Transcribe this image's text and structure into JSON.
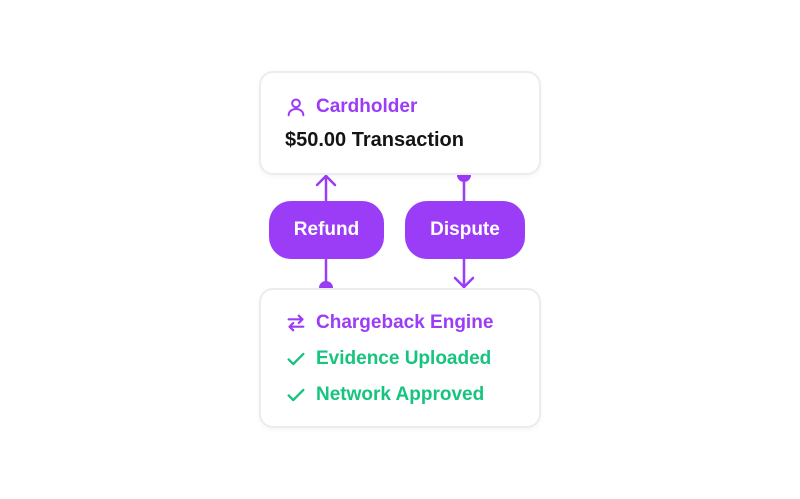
{
  "colors": {
    "accent": "#9b3cf6",
    "success": "#16c47f",
    "text": "#141414"
  },
  "cardholder": {
    "title": "Cardholder",
    "title_icon": "user-icon",
    "transaction": "$50.00 Transaction"
  },
  "actions": {
    "refund": "Refund",
    "dispute": "Dispute"
  },
  "engine": {
    "title": "Chargeback Engine",
    "title_icon": "swap-arrows-icon",
    "steps": [
      {
        "label": "Evidence Uploaded",
        "icon": "check-icon"
      },
      {
        "label": "Network Approved",
        "icon": "check-icon"
      }
    ]
  }
}
